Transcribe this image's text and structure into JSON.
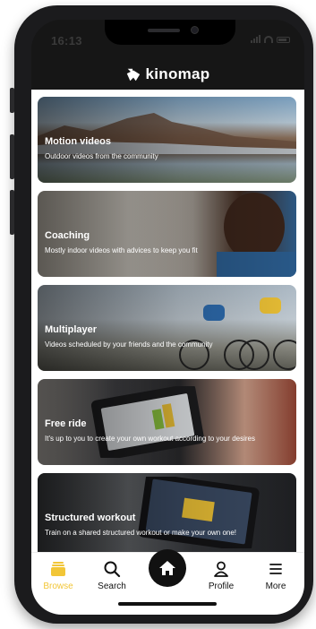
{
  "status_bar": {
    "time": "16:13"
  },
  "header": {
    "brand": "kinomap",
    "logo_icon": "kinomap-logo-icon"
  },
  "cards": [
    {
      "title": "Motion videos",
      "description": "Outdoor videos from the community"
    },
    {
      "title": "Coaching",
      "description": "Mostly indoor videos with advices to keep you fit"
    },
    {
      "title": "Multiplayer",
      "description": "Videos scheduled by your friends and the community"
    },
    {
      "title": "Free ride",
      "description": "It's up to you to create your own workout according to your desires"
    },
    {
      "title": "Structured workout",
      "description": "Train on a shared structured workout or make your own one!"
    }
  ],
  "tabbar": {
    "browse": {
      "label": "Browse",
      "icon": "browse-icon"
    },
    "search": {
      "label": "Search",
      "icon": "search-icon"
    },
    "home": {
      "icon": "home-icon"
    },
    "profile": {
      "label": "Profile",
      "icon": "profile-icon"
    },
    "more": {
      "label": "More",
      "icon": "menu-icon"
    }
  },
  "colors": {
    "accent": "#f2c637",
    "header_bg": "#161616",
    "phone_frame": "#1b1b1d"
  }
}
